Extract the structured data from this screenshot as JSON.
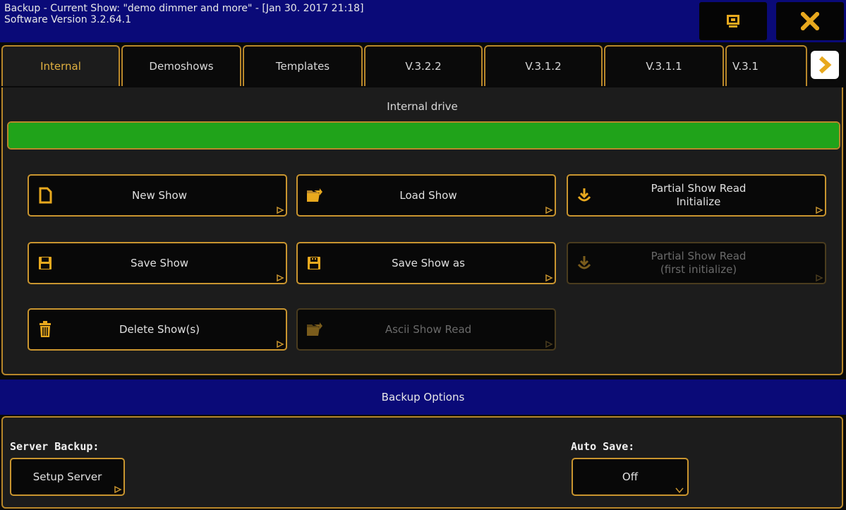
{
  "window": {
    "title_line1": "Backup - Current Show: \"demo dimmer and more\" - [Jan 30. 2017 21:18]",
    "title_line2": "Software Version 3.2.64.1"
  },
  "tabs": [
    {
      "label": "Internal",
      "active": true
    },
    {
      "label": "Demoshows"
    },
    {
      "label": "Templates"
    },
    {
      "label": "V.3.2.2"
    },
    {
      "label": "V.3.1.2"
    },
    {
      "label": "V.3.1.1"
    },
    {
      "label": "V.3.1"
    }
  ],
  "drive": {
    "label": "Internal drive",
    "usage_fraction": 1.0,
    "bar_color": "#20a31a"
  },
  "actions": {
    "new_show": "New Show",
    "load_show": "Load Show",
    "partial_read_line1": "Partial Show Read",
    "partial_read_line2": "Initialize",
    "save_show": "Save Show",
    "save_show_as": "Save Show as",
    "partial_first_line1": "Partial Show Read",
    "partial_first_line2": "(first initialize)",
    "delete_show": "Delete Show(s)",
    "ascii_read": "Ascii Show Read"
  },
  "backup_options": {
    "header": "Backup Options",
    "server_label": "Server Backup:",
    "server_button": "Setup Server",
    "autosave_label": "Auto Save:",
    "autosave_value": "Off"
  },
  "colors": {
    "accent": "#c9952f",
    "title_bg": "#0a0a78",
    "icon": "#e8a91e"
  }
}
